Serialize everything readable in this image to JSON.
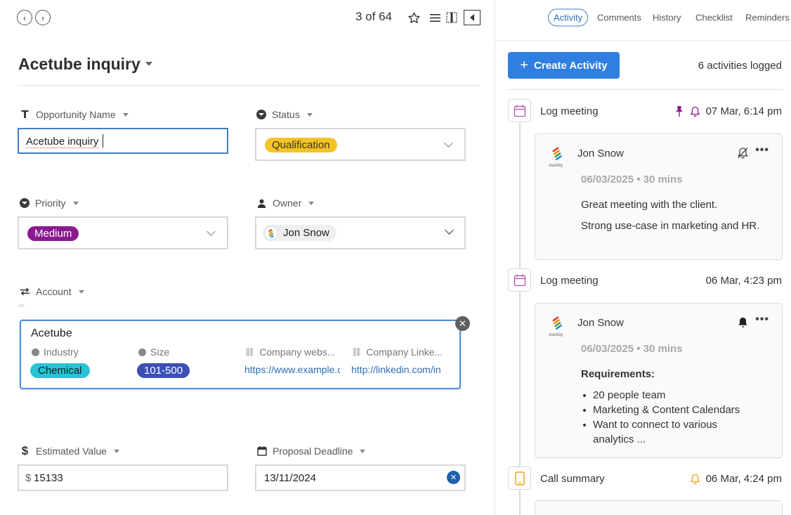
{
  "toolbar": {
    "back_label": "‹",
    "forward_label": "›",
    "counter": "3 of 64"
  },
  "record": {
    "title": "Acetube inquiry"
  },
  "fields": {
    "opportunity_name": {
      "label": "Opportunity Name",
      "value": "Acetube inquiry"
    },
    "status": {
      "label": "Status",
      "value": "Qualification",
      "color": "#f6c324"
    },
    "priority": {
      "label": "Priority",
      "value": "Medium",
      "color": "#8a1a8f"
    },
    "owner": {
      "label": "Owner",
      "value": "Jon Snow"
    },
    "account": {
      "label": "Account"
    },
    "estimated_value": {
      "label": "Estimated Value",
      "currency": "$",
      "value": "15133"
    },
    "proposal_deadline": {
      "label": "Proposal Deadline",
      "value": "13/11/2024"
    }
  },
  "account_card": {
    "name": "Acetube",
    "industry_label": "Industry",
    "industry_value": "Chemical",
    "industry_color": "#27c3d6",
    "size_label": "Size",
    "size_value": "101-500",
    "size_color": "#3b4fb5",
    "website_label": "Company webs...",
    "website_value": "https://www.example.com",
    "linkedin_label": "Company Linke...",
    "linkedin_value": "http://linkedin.com/in"
  },
  "right_tabs": [
    "Activity",
    "Comments",
    "History",
    "Checklist",
    "Reminders"
  ],
  "activity": {
    "create_label": "Create Activity",
    "logged_text": "6 activities logged",
    "items": [
      {
        "title": "Log meeting",
        "time": "07 Mar, 6:14 pm",
        "author": "Jon Snow",
        "meta": "06/03/2025 • 30 mins",
        "lines": [
          "Great meeting with the client.",
          "Strong use-case in marketing and HR."
        ]
      },
      {
        "title": "Log meeting",
        "time": "06 Mar, 4:23 pm",
        "author": "Jon Snow",
        "meta": "06/03/2025 • 30 mins",
        "heading": "Requirements:",
        "bullets": [
          "20 people team",
          "Marketing & Content Calendars",
          "Want to connect to various analytics ..."
        ]
      },
      {
        "title": "Call summary",
        "time": "06 Mar, 4:24 pm"
      }
    ]
  },
  "logo_text": "stackby",
  "colors": {
    "accent": "#2f7fe0",
    "pin": "#8a1a8f",
    "reminder_bell": "#f0a11a"
  },
  "icons": [
    "back-icon",
    "forward-icon",
    "star-icon",
    "list-icon",
    "columns-icon",
    "collapse-panel-icon",
    "calendar-icon",
    "pin-icon",
    "bell-icon",
    "bell-off-icon",
    "more-icon",
    "phone-icon",
    "plus-icon",
    "close-icon",
    "link-icon"
  ]
}
